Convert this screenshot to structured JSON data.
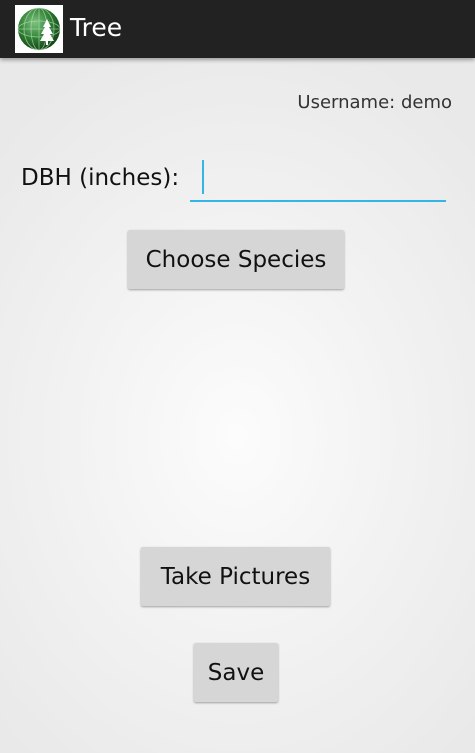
{
  "app": {
    "title": "Tree",
    "icon": "globe-tree-icon"
  },
  "header": {
    "username_text": "Username: demo"
  },
  "form": {
    "dbh_label": "DBH (inches):",
    "dbh_value": "",
    "choose_species_label": "Choose Species",
    "take_pictures_label": "Take Pictures",
    "save_label": "Save"
  },
  "colors": {
    "accent": "#33b5e5",
    "actionbar": "#222222",
    "icon_green": "#2e7d32"
  }
}
